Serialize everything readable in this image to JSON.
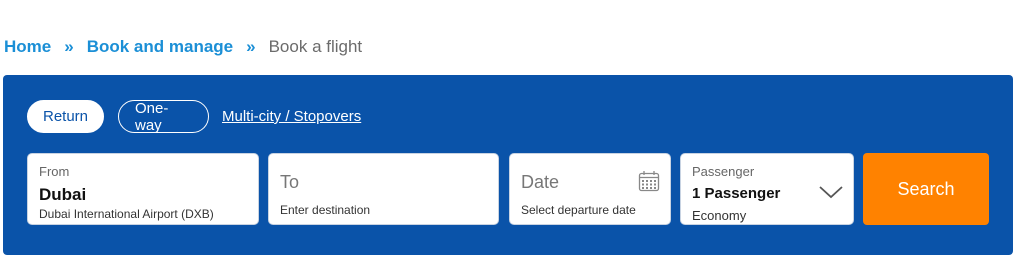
{
  "breadcrumb": {
    "home": "Home",
    "separator_1": "»",
    "book_manage": "Book and manage",
    "separator_2": "»",
    "current": "Book a flight"
  },
  "trip_type": {
    "options": [
      "Return",
      "One-way",
      "Multi-city / Stopovers"
    ],
    "selected": "Return"
  },
  "from": {
    "label": "From",
    "city": "Dubai",
    "airport": "Dubai International Airport (DXB)"
  },
  "to": {
    "label": "To",
    "placeholder": "Enter destination"
  },
  "date": {
    "label": "Date",
    "placeholder": "Select departure date",
    "icon": "calendar-icon"
  },
  "passenger": {
    "label": "Passenger",
    "value": "1 Passenger",
    "cabin": "Economy",
    "icon": "chevron-down-icon"
  },
  "search": {
    "label": "Search"
  },
  "colors": {
    "panel": "#0a53a9",
    "link": "#1b8fd6",
    "search_button": "#ff8200"
  }
}
